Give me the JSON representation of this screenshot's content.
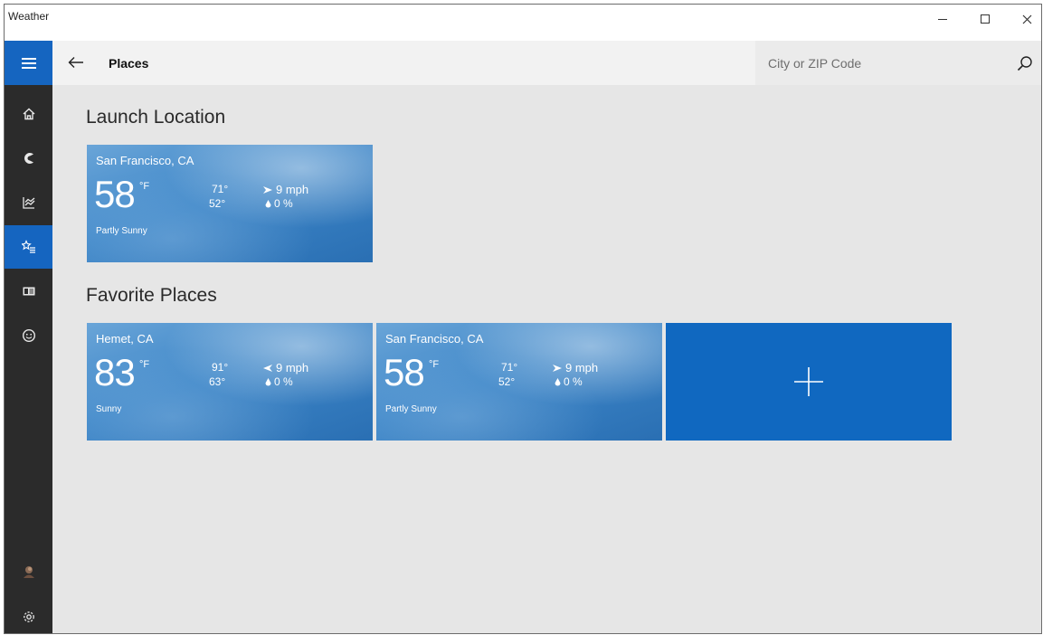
{
  "window": {
    "title": "Weather"
  },
  "header": {
    "page_title": "Places",
    "search_placeholder": "City or ZIP Code"
  },
  "rail": {
    "items": [
      {
        "icon": "home-icon"
      },
      {
        "icon": "forecast-icon"
      },
      {
        "icon": "historical-weather-icon"
      },
      {
        "icon": "places-icon",
        "active": true
      },
      {
        "icon": "news-icon"
      },
      {
        "icon": "feedback-icon"
      }
    ],
    "bottom": [
      {
        "icon": "avatar"
      },
      {
        "icon": "gear-icon"
      }
    ]
  },
  "sections": {
    "launch_title": "Launch Location",
    "favorites_title": "Favorite Places"
  },
  "launch_tile": {
    "city": "San Francisco, CA",
    "temp": "58",
    "unit": "°F",
    "high": "71°",
    "low": "52°",
    "wind": "9 mph",
    "precip": "0 %",
    "condition": "Partly Sunny"
  },
  "favorites": [
    {
      "city": "Hemet, CA",
      "temp": "83",
      "unit": "°F",
      "high": "91°",
      "low": "63°",
      "wind": "9 mph",
      "precip": "0 %",
      "condition": "Sunny"
    },
    {
      "city": "San Francisco, CA",
      "temp": "58",
      "unit": "°F",
      "high": "71°",
      "low": "52°",
      "wind": "9 mph",
      "precip": "0 %",
      "condition": "Partly Sunny"
    }
  ],
  "add_tile": {
    "icon": "plus-icon"
  },
  "colors": {
    "accent": "#1565c0",
    "add_tile": "#1068c0",
    "rail": "#2b2b2b",
    "content_bg": "#e6e6e6"
  }
}
